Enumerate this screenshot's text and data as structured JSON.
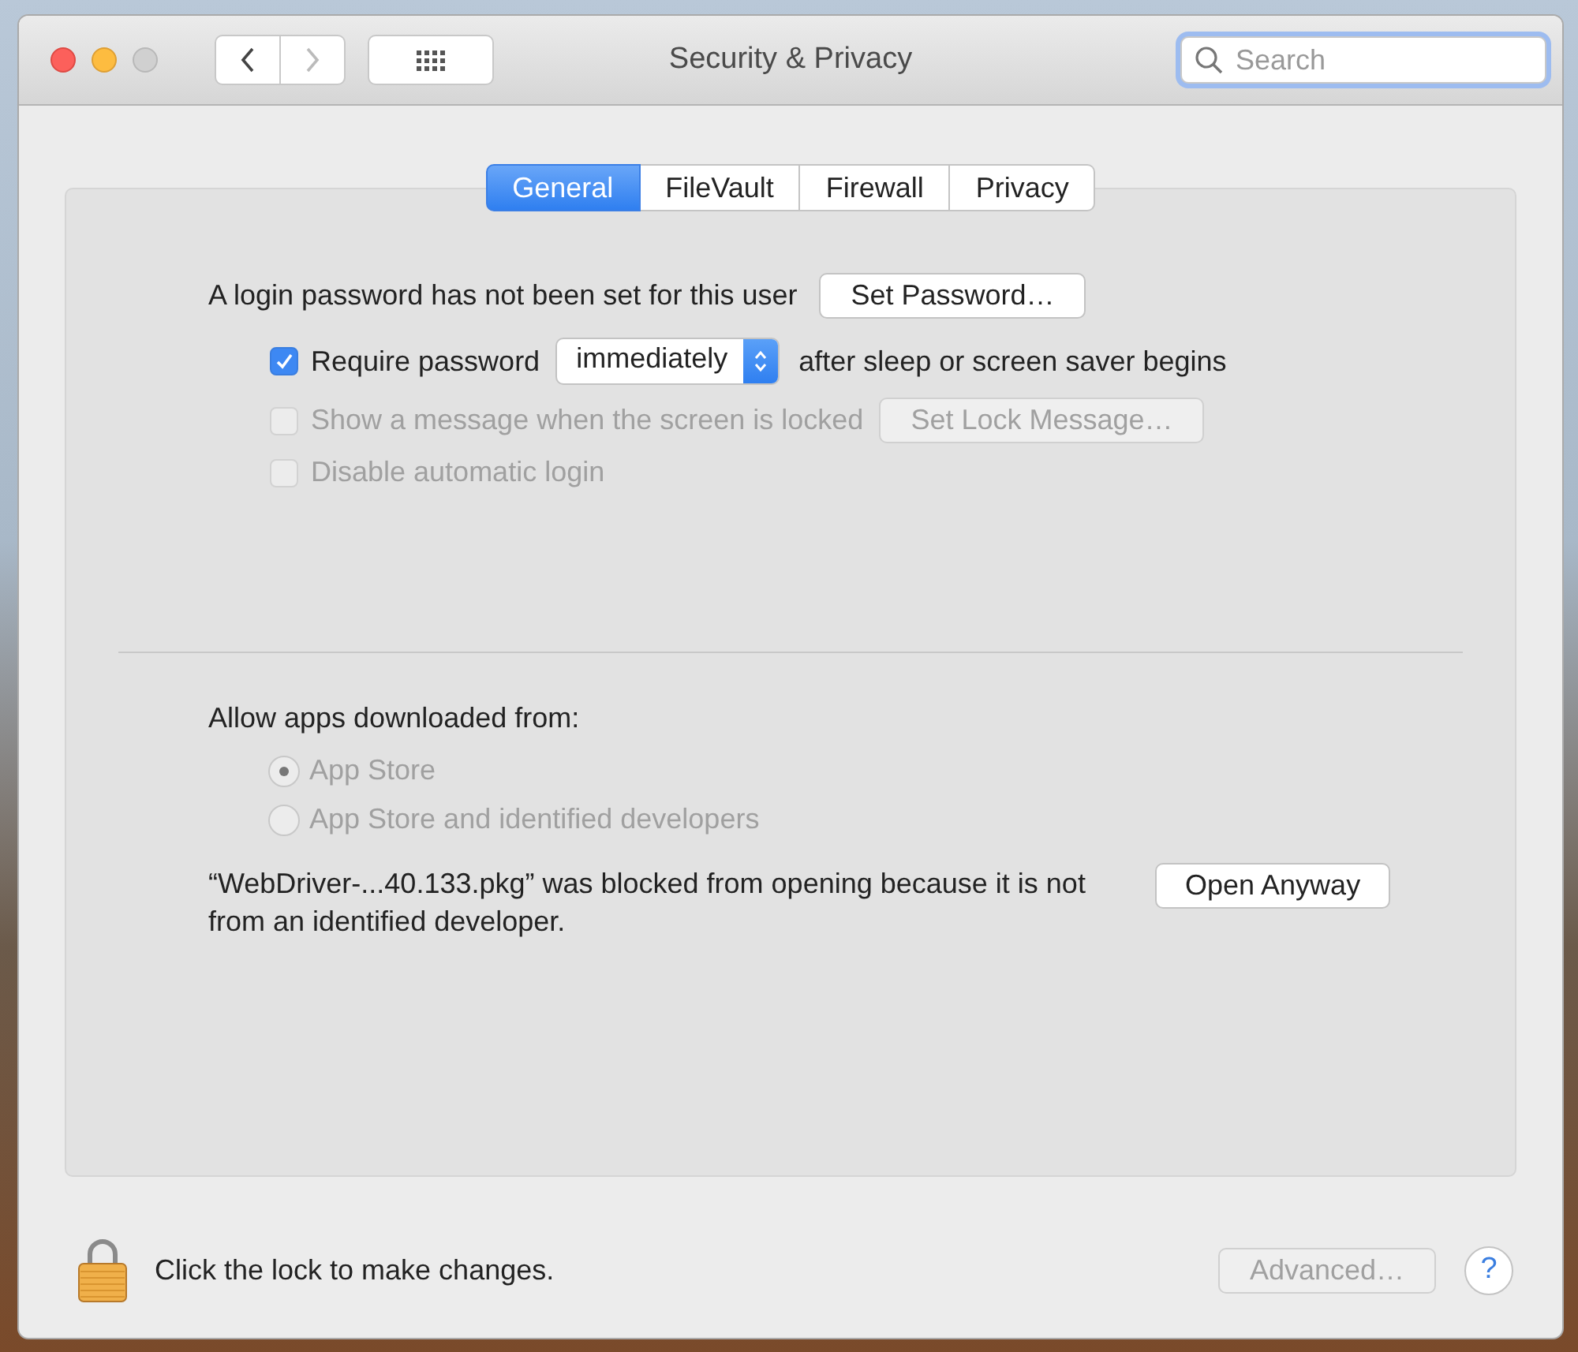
{
  "window": {
    "title": "Security & Privacy",
    "nav": [
      {
        "kind": "back",
        "disabled": false
      },
      {
        "kind": "forward",
        "disabled": true
      }
    ],
    "search": {
      "placeholder": "Search"
    }
  },
  "tabs": [
    {
      "label": "General",
      "selected": true
    },
    {
      "label": "FileVault",
      "selected": false
    },
    {
      "label": "Firewall",
      "selected": false
    },
    {
      "label": "Privacy",
      "selected": false
    }
  ],
  "password": {
    "label": "A login password has not been set for this user",
    "button": "Set Password…"
  },
  "options": [
    {
      "kind": "popup",
      "label": "Require password",
      "checked": true,
      "disabled": false,
      "popup": "immediately",
      "suffix": "after sleep or screen saver begins"
    },
    {
      "kind": "button",
      "label": "Show a message when the screen is locked",
      "checked": false,
      "disabled": true,
      "button": "Set Lock Message…"
    },
    {
      "kind": "plain",
      "label": "Disable automatic login",
      "checked": false,
      "disabled": true
    }
  ],
  "gatekeeper": {
    "heading": "Allow apps downloaded from:",
    "radios": [
      {
        "label": "App Store",
        "selected": true,
        "disabled": true
      },
      {
        "label": "App Store and identified developers",
        "selected": false,
        "disabled": true
      }
    ],
    "message": "“WebDriver-...40.133.pkg” was blocked from opening because it is not from an identified developer.",
    "button": "Open Anyway"
  },
  "footer": {
    "lock_text": "Click the lock to make changes.",
    "advanced": {
      "label": "Advanced…",
      "disabled": true
    },
    "help": "?"
  }
}
